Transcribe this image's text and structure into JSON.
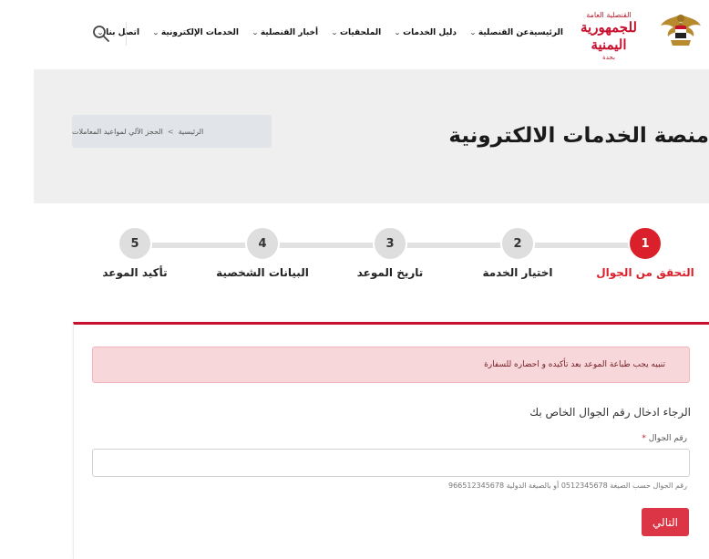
{
  "header": {
    "logo": {
      "small_text": "القنصلية العامة",
      "main_text": "للجمهورية اليمنية",
      "city_text": "بجدة"
    },
    "nav": [
      {
        "label": "الرئيسية",
        "has_dropdown": false
      },
      {
        "label": "عن القنصلية",
        "has_dropdown": true
      },
      {
        "label": "دليل الخدمات",
        "has_dropdown": true
      },
      {
        "label": "الملحقيات",
        "has_dropdown": true
      },
      {
        "label": "أخبار القنصلية",
        "has_dropdown": true
      },
      {
        "label": "الخدمات الإلكترونية",
        "has_dropdown": true
      },
      {
        "label": "اتصل بنا",
        "has_dropdown": true
      }
    ],
    "search_icon": "search-icon"
  },
  "page": {
    "title": "منصة الخدمات الالكترونية",
    "breadcrumb": {
      "home": "الرئيسية",
      "separator": ">",
      "current": "الحجز الآلي لمواعيد المعاملات"
    }
  },
  "stepper": {
    "active_step": 1,
    "steps": [
      {
        "number": "1",
        "label": "التحقق من الجوال"
      },
      {
        "number": "2",
        "label": "اختيار الخدمة"
      },
      {
        "number": "3",
        "label": "تاريخ الموعد"
      },
      {
        "number": "4",
        "label": "البيانات الشخصية"
      },
      {
        "number": "5",
        "label": "تأكيد الموعد"
      }
    ]
  },
  "form": {
    "alert": "تنبيه يجب طباعة الموعد بعد تأكيده و احضاره للسفارة",
    "heading": "الرجاء ادخال رقم الجوال الخاص بك",
    "phone_label": "رقم الجوال",
    "required_mark": "*",
    "phone_value": "",
    "phone_placeholder": "",
    "hint": "رقم الجوال حسب الصيغة 0512345678 أو بالصيغة الدولية 966512345678",
    "next_button": "التالي"
  },
  "colors": {
    "brand_red": "#c8102e",
    "step_active": "#d9202b",
    "button_red": "#dc3545",
    "alert_bg": "#f8d7da",
    "step_inactive": "#dedede"
  }
}
